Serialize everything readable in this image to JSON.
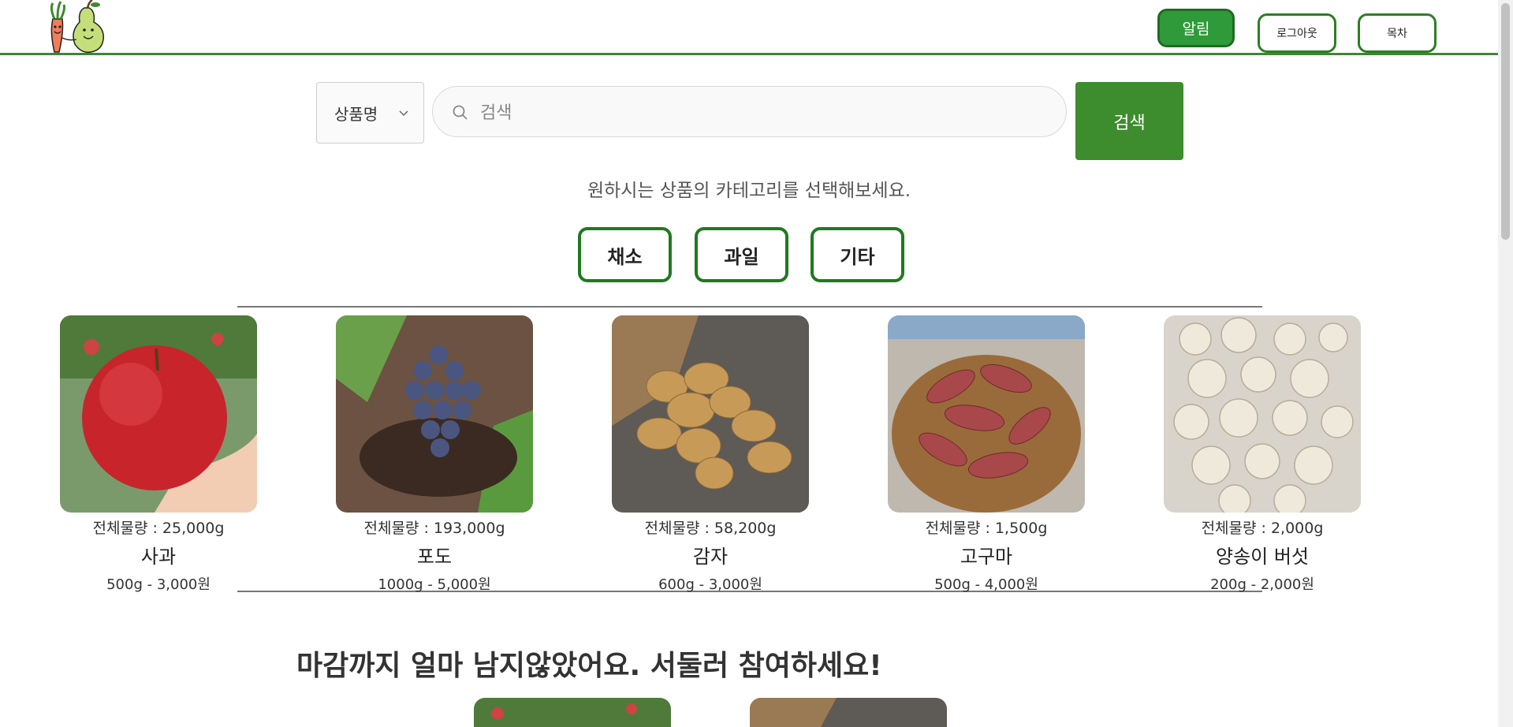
{
  "header": {
    "alarm_label": "알림",
    "logout_label": "로그아웃",
    "toc_label": "목차"
  },
  "search": {
    "select_value": "상품명",
    "placeholder": "검색",
    "button_label": "검색"
  },
  "categories": {
    "hint": "원하시는 상품의 카테고리를 선택해보세요.",
    "items": [
      "채소",
      "과일",
      "기타"
    ]
  },
  "products": [
    {
      "name": "사과",
      "qty": "전체물량 : 25,000g",
      "price": "500g - 3,000원",
      "image": "apple"
    },
    {
      "name": "포도",
      "qty": "전체물량 : 193,000g",
      "price": "1000g - 5,000원",
      "image": "grapes"
    },
    {
      "name": "감자",
      "qty": "전체물량 : 58,200g",
      "price": "600g - 3,000원",
      "image": "potatoes"
    },
    {
      "name": "고구마",
      "qty": "전체물량 : 1,500g",
      "price": "500g - 4,000원",
      "image": "sweet-potatoes"
    },
    {
      "name": "양송이 버섯",
      "qty": "전체물량 : 2,000g",
      "price": "200g - 2,000원",
      "image": "mushrooms"
    }
  ],
  "deadline": {
    "title": "마감까지 얼마 남지않았어요. 서둘러 참여하세요!"
  },
  "colors": {
    "brand_green": "#3d8c2e",
    "border_green": "#1f7a1f"
  }
}
